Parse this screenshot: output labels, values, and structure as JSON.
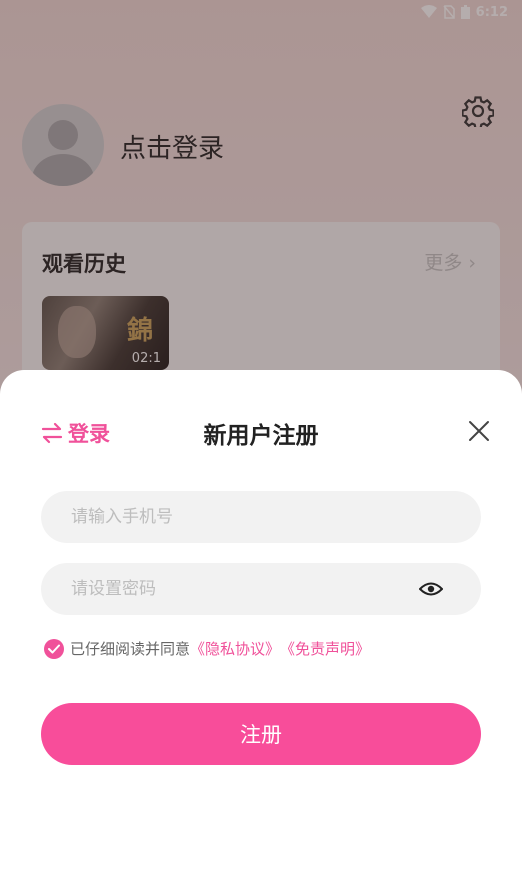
{
  "status_bar": {
    "time": "6:12"
  },
  "profile": {
    "login_text": "点击登录"
  },
  "history": {
    "title": "观看历史",
    "more": "更多 ›",
    "items": [
      {
        "duration": "02:1",
        "poster_glyph": "錦"
      }
    ]
  },
  "sheet": {
    "switch_label": "登录",
    "title": "新用户注册",
    "phone_placeholder": "请输入手机号",
    "password_placeholder": "请设置密码",
    "agree_prefix": "已仔细阅读并同意",
    "privacy_link": "《隐私协议》",
    "disclaimer_link": "《免责声明》",
    "register_label": "注册"
  },
  "colors": {
    "accent": "#f84d9a",
    "link": "#f0519a"
  }
}
